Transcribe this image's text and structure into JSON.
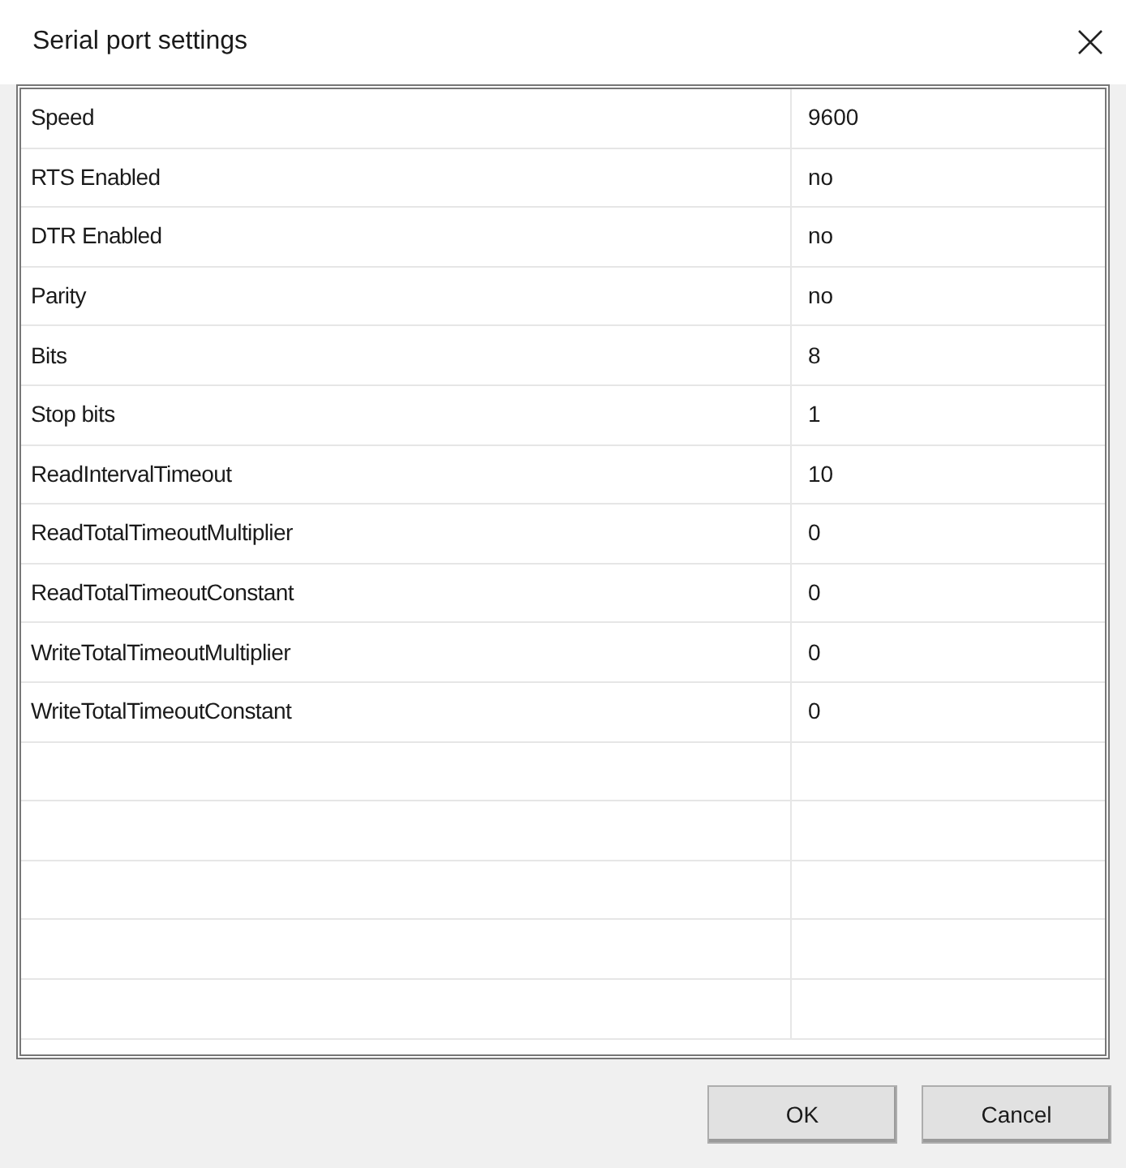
{
  "window": {
    "title": "Serial port settings"
  },
  "table": {
    "rows": [
      {
        "name": "Speed",
        "value": "9600"
      },
      {
        "name": "RTS Enabled",
        "value": "no"
      },
      {
        "name": "DTR Enabled",
        "value": "no"
      },
      {
        "name": "Parity",
        "value": "no"
      },
      {
        "name": "Bits",
        "value": "8"
      },
      {
        "name": "Stop bits",
        "value": "1"
      },
      {
        "name": "ReadIntervalTimeout",
        "value": "10"
      },
      {
        "name": "ReadTotalTimeoutMultiplier",
        "value": "0"
      },
      {
        "name": "ReadTotalTimeoutConstant",
        "value": "0"
      },
      {
        "name": "WriteTotalTimeoutMultiplier",
        "value": "0"
      },
      {
        "name": "WriteTotalTimeoutConstant",
        "value": "0"
      }
    ]
  },
  "buttons": [
    "OK",
    "Cancel"
  ]
}
